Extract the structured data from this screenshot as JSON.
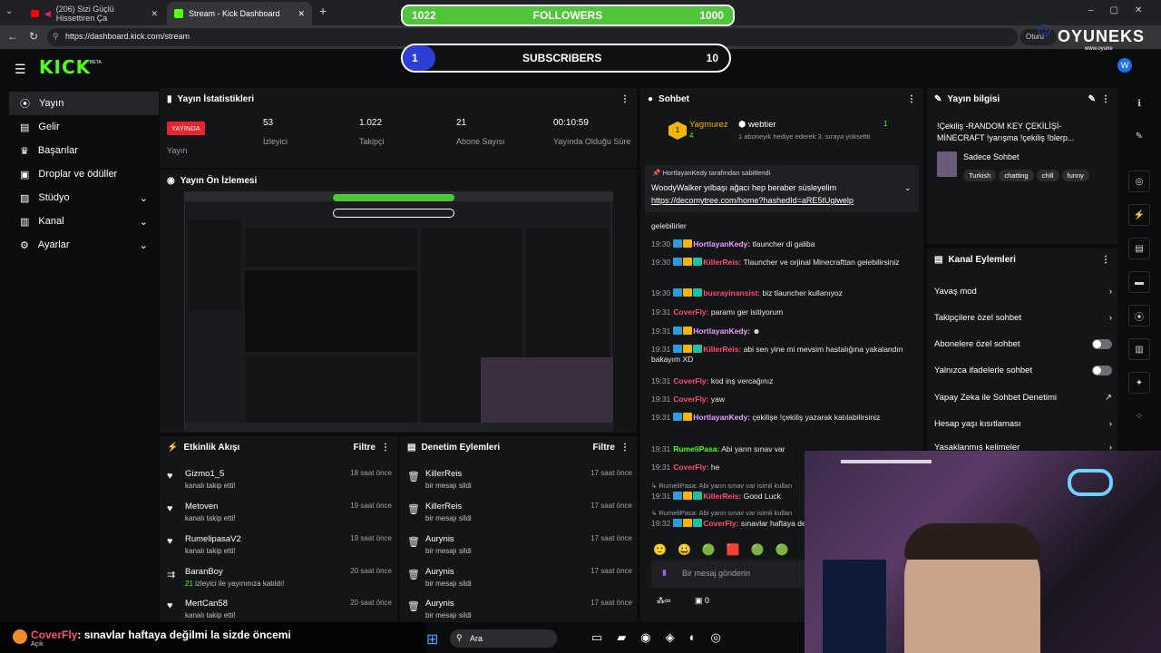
{
  "browser": {
    "tabs": [
      {
        "title": "(206) Sizi Güçlü Hissettiren Ça"
      },
      {
        "title": "Stream - Kick Dashboard"
      }
    ],
    "new_tab": "+",
    "url": "https://dashboard.kick.com/stream",
    "profile_chip": "Oturu"
  },
  "overlay": {
    "followers": {
      "label": "FOLLOWERS",
      "current": "1022",
      "goal": "1000",
      "progress": 1.0
    },
    "subscribers": {
      "label": "SUBSCRIBERS",
      "current": "1",
      "goal": "10",
      "progress": 0.1
    },
    "brand": "OYUNEKS",
    "brand_url": "www.oyune"
  },
  "kick": {
    "logo": "KICK",
    "logo_beta": "BETA",
    "sidebar": [
      {
        "label": "Yayın",
        "icon": "broadcast-icon",
        "active": true
      },
      {
        "label": "Gelir",
        "icon": "wallet-icon"
      },
      {
        "label": "Başarılar",
        "icon": "trophy-icon"
      },
      {
        "label": "Droplar ve ödüller",
        "icon": "gift-icon"
      },
      {
        "label": "Stüdyo",
        "icon": "studio-icon",
        "expand": true
      },
      {
        "label": "Kanal",
        "icon": "channel-icon",
        "expand": true
      },
      {
        "label": "Ayarlar",
        "icon": "gear-icon",
        "expand": true
      }
    ],
    "stats": {
      "title": "Yayın İstatistikleri",
      "live_badge": "YAYINDA",
      "live_label": "Yayın",
      "items": [
        {
          "value": "53",
          "label": "İzleyici"
        },
        {
          "value": "1.022",
          "label": "Takipçi"
        },
        {
          "value": "21",
          "label": "Abone Sayısı"
        },
        {
          "value": "00:10:59",
          "label": "Yayında Olduğu Süre"
        }
      ]
    },
    "preview": {
      "title": "Yayın Ön İzlemesi"
    },
    "activity": {
      "title": "Etkinlik Akışı",
      "filter": "Filtre",
      "rows": [
        {
          "name": "Gizmo1_5",
          "action": "kanalı takip etti!",
          "time": "18 saat önce",
          "icon": "heart-icon"
        },
        {
          "name": "Metoven",
          "action": "kanalı takip etti!",
          "time": "19 saat önce",
          "icon": "heart-icon"
        },
        {
          "name": "RumelipasaV2",
          "action": "kanalı takip etti!",
          "time": "19 saat önce",
          "icon": "heart-icon"
        },
        {
          "name": "BaranBoy",
          "count": "21",
          "action": "izleyici ile yayınınıza katıldı!",
          "time": "20 saat önce",
          "icon": "raid-icon"
        },
        {
          "name": "MertCan58",
          "action": "kanalı takip etti!",
          "time": "20 saat önce",
          "icon": "heart-icon"
        }
      ]
    },
    "moderation": {
      "title": "Denetim Eylemleri",
      "filter": "Filtre",
      "rows": [
        {
          "name": "KillerReis",
          "action": "bir mesajı sildi",
          "time": "17 saat önce"
        },
        {
          "name": "KillerReis",
          "action": "bir mesajı sildi",
          "time": "17 saat önce"
        },
        {
          "name": "Aurynis",
          "action": "bir mesajı sildi",
          "time": "17 saat önce"
        },
        {
          "name": "Aurynis",
          "action": "bir mesajı sildi",
          "time": "17 saat önce"
        },
        {
          "name": "Aurynis",
          "action": "bir mesajı sildi",
          "time": "17 saat önce"
        }
      ]
    },
    "chat": {
      "title": "Sohbet",
      "top_gifter": {
        "name": "Yagmurez",
        "count": "4"
      },
      "gift_event": {
        "name": "webtier",
        "count": "1",
        "text": "1 aboneyik hediye ederek 3. sıraya yükseltti"
      },
      "pinned": {
        "by": "HortlayanKedy tarafından sabitlendi",
        "text": "WoodyWalker yılbaşı ağacı hep beraber süsleyelim",
        "link": "https://decomytree.com/home?hashedId=aRE5tUgiwelp"
      },
      "messages": [
        {
          "time": "",
          "user": "",
          "text": "gelebilirler"
        },
        {
          "time": "19:30",
          "user": "HortlayanKedy:",
          "text": "tlauncher di galiba",
          "color": "#e8a0ff"
        },
        {
          "time": "19:30",
          "user": "KillerReis:",
          "text": "Tlauncher ve orjinal Minecrafttan gelebilirsiniz",
          "color": "#ff4d6d"
        },
        {
          "time": "19:30",
          "user": "busrayinansist:",
          "text": "biz tlauncher kullanıyoz",
          "color": "#ff4d6d"
        },
        {
          "time": "19:31",
          "user": "CoverFly:",
          "text": "paramı ger isitiyorum",
          "color": "#ff4d6d"
        },
        {
          "time": "19:31",
          "user": "HortlayanKedy:",
          "text": "",
          "color": "#e8a0ff"
        },
        {
          "time": "19:31",
          "user": "KillerReis:",
          "text": "abi sen yine mi mevsim hastalığına yakalandın bakayım XD",
          "color": "#ff4d6d"
        },
        {
          "time": "19:31",
          "user": "CoverFly:",
          "text": "kod inş vercağınız",
          "color": "#ff4d6d"
        },
        {
          "time": "19:31",
          "user": "CoverFly:",
          "text": "yaw",
          "color": "#ff4d6d"
        },
        {
          "time": "19:31",
          "user": "HortlayanKedy:",
          "text": "çekilişe !çekiliş yazarak katılabilirsiniz",
          "color": "#e8a0ff"
        },
        {
          "time": "19:31",
          "user": "RumeliPasa:",
          "text": "Abi yarın sınav var",
          "color": "#53fc18"
        },
        {
          "time": "19:31",
          "user": "CoverFly:",
          "text": "he",
          "color": "#ff4d6d"
        },
        {
          "time": "",
          "user": "RumeliPasa:",
          "text": "Abi yarın sınav var isimli kullan",
          "color": "#9aa0a6"
        },
        {
          "time": "19:31",
          "user": "KillerReis:",
          "text": "Good Luck",
          "color": "#ff4d6d"
        },
        {
          "time": "",
          "user": "RumeliPasa:",
          "text": "Abi yarın sınav var isimli kullan",
          "color": "#9aa0a6"
        },
        {
          "time": "19:32",
          "user": "CoverFly:",
          "text": "sınavlar haftaya değilmi",
          "color": "#ff4d6d"
        }
      ],
      "input_placeholder": "Bir mesaj gönderin",
      "footer_count": "0"
    },
    "stream_info": {
      "title": "Yayın bilgisi",
      "stream_title": "!Çekiliş -RANDOM KEY ÇEKİLİŞİ- MİNECRAFT !yarışma !çekiliş !blerp...",
      "category": "Sadece Sohbet",
      "tags": [
        "Turkish",
        "chatting",
        "chill",
        "funny"
      ]
    },
    "channel_actions": {
      "title": "Kanal Eylemleri",
      "rows": [
        {
          "label": "Yavaş mod",
          "control": "chevron"
        },
        {
          "label": "Takipçilere özel sohbet",
          "control": "chevron"
        },
        {
          "label": "Abonelere özel sohbet",
          "control": "toggle"
        },
        {
          "label": "Yalnızca ifadelerle sohbet",
          "control": "toggle"
        },
        {
          "label": "Yapay Zeka ile Sohbet Denetimi",
          "control": "external"
        },
        {
          "label": "Hesap yaşı kısıtlaması",
          "control": "chevron"
        },
        {
          "label": "Yasaklanmış kelimeler",
          "control": "chevron"
        }
      ]
    }
  },
  "ticker": {
    "user": "CoverFly",
    "text": ": sınavlar haftaya değilmi la sizde öncemi",
    "sub": "Açık"
  },
  "taskbar": {
    "search": "Ara"
  },
  "colors": {
    "kick_green": "#53fc18",
    "live_red": "#e5242b",
    "follower_bar": "#4fc53a",
    "panel": "#141517"
  }
}
